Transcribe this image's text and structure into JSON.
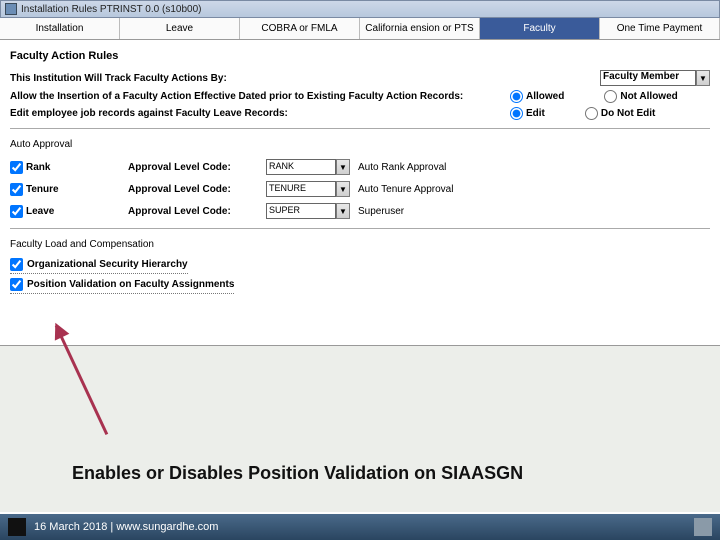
{
  "window": {
    "title": "Installation Rules  PTRINST  0.0  (s10b00)"
  },
  "tabs": {
    "items": [
      "Installation",
      "Leave",
      "COBRA or FMLA",
      "California ension or PTS",
      "Faculty",
      "One Time Payment"
    ],
    "activeIndex": 4
  },
  "section1": {
    "title": "Faculty Action Rules",
    "row1": {
      "label": "This Institution Will Track Faculty Actions By:",
      "value": "Faculty Member"
    },
    "row2": {
      "label": "Allow the Insertion of a Faculty Action Effective Dated prior to Existing Faculty Action Records:",
      "opt1": "Allowed",
      "opt2": "Not Allowed",
      "selected": "Allowed"
    },
    "row3": {
      "label": "Edit employee job records against Faculty Leave Records:",
      "opt1": "Edit",
      "opt2": "Do Not Edit",
      "selected": "Edit"
    }
  },
  "section2": {
    "title": "Auto Approval",
    "approvalLabel": "Approval Level Code:",
    "rows": [
      {
        "name": "Rank",
        "checked": true,
        "code": "RANK",
        "desc": "Auto Rank Approval"
      },
      {
        "name": "Tenure",
        "checked": true,
        "code": "TENURE",
        "desc": "Auto Tenure Approval"
      },
      {
        "name": "Leave",
        "checked": true,
        "code": "SUPER",
        "desc": "Superuser"
      }
    ]
  },
  "section3": {
    "title": "Faculty Load and Compensation",
    "rows": [
      {
        "label": "Organizational Security Hierarchy",
        "checked": true
      },
      {
        "label": "Position Validation on Faculty Assignments",
        "checked": true
      }
    ]
  },
  "callout": "Enables or Disables Position Validation on SIAASGN",
  "footer": "16 March 2018 | www.sungardhe.com"
}
